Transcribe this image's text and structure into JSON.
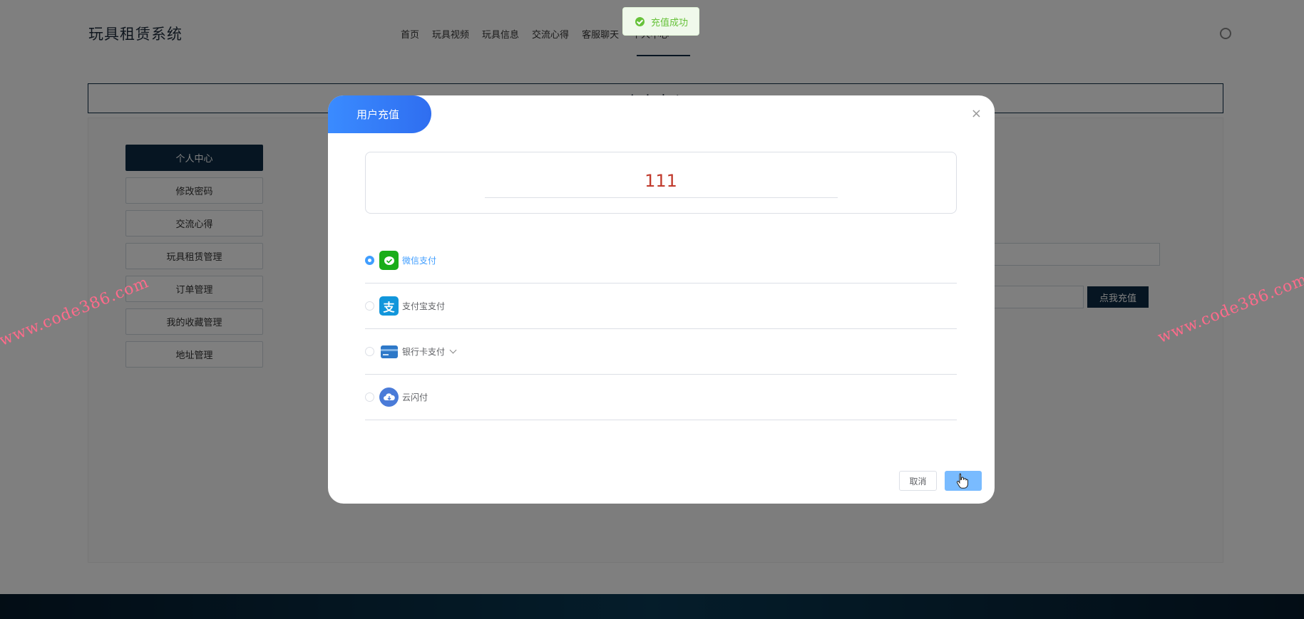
{
  "header": {
    "brand": "玩具租赁系统",
    "nav": [
      "首页",
      "玩具视频",
      "玩具信息",
      "交流心得",
      "客服聊天",
      "个人中心"
    ]
  },
  "page_title": "个人中心",
  "side_menu": [
    "个人中心",
    "修改密码",
    "交流心得",
    "玩具租赁管理",
    "订单管理",
    "我的收藏管理",
    "地址管理"
  ],
  "background": {
    "recharge_button": "点我充值"
  },
  "toast": {
    "message": "充值成功"
  },
  "dialog": {
    "title": "用户充值",
    "close": "×",
    "amount": "111",
    "payment_methods": [
      {
        "label": "微信支付",
        "icon": "wechat-icon",
        "color": "#1aad19",
        "selected": true
      },
      {
        "label": "支付宝支付",
        "icon": "alipay-icon",
        "color": "#1296db",
        "selected": false
      },
      {
        "label": "银行卡支付",
        "icon": "bank-card-icon",
        "color": "#2d78c8",
        "selected": false
      },
      {
        "label": "云闪付",
        "icon": "unionpay-cloud-icon",
        "color": "#4a7bd8",
        "selected": false
      }
    ],
    "cancel": "取消"
  },
  "watermark": "www.code386.com",
  "colors": {
    "primary": "#409eff",
    "dark": "#0d2b45",
    "success": "#67c23a",
    "amount": "#c0392b"
  }
}
